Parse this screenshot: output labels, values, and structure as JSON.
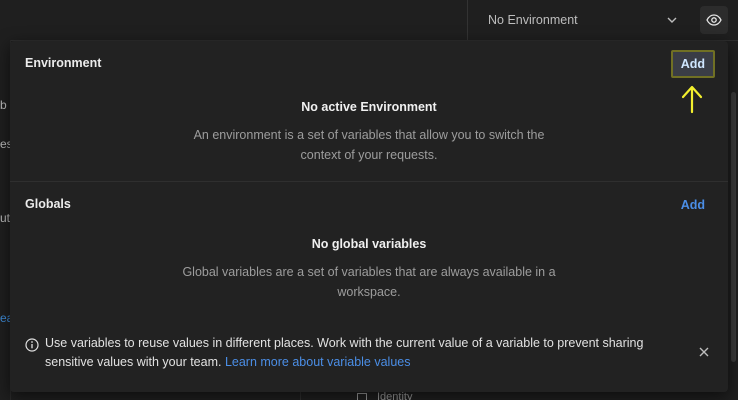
{
  "topbar": {
    "environment_select": {
      "label": "No Environment",
      "icon": "chevron-down-icon"
    },
    "eye_button": {
      "icon": "eye-icon"
    }
  },
  "background": {
    "left_fragments": [
      "b",
      "es",
      "ut",
      "ea"
    ],
    "bottom_row_text": "Identity"
  },
  "environment_panel": {
    "environment_section": {
      "title": "Environment",
      "add_label": "Add",
      "empty_title": "No active Environment",
      "empty_description": "An environment is a set of variables that allow you to switch the context of your requests."
    },
    "globals_section": {
      "title": "Globals",
      "add_label": "Add",
      "empty_title": "No global variables",
      "empty_description": "Global variables are a set of variables that are always available in a workspace."
    },
    "info": {
      "text": "Use variables to reuse values in different places. Work with the current value of a variable to prevent sharing sensitive values with your team.",
      "link": "Learn more about variable values"
    }
  },
  "colors": {
    "accent_link": "#4b8ee6",
    "highlight_border": "#707024",
    "arrow": "#f2ef2e",
    "panel_bg": "#222222"
  }
}
